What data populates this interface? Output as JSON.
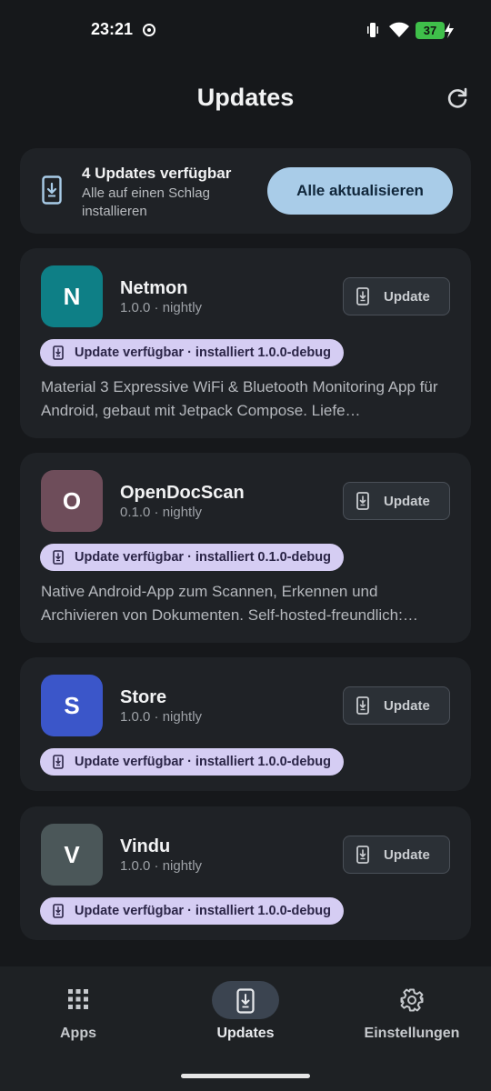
{
  "status_bar": {
    "time": "23:21",
    "battery": "37"
  },
  "header": {
    "title": "Updates"
  },
  "banner": {
    "title": "4 Updates verfügbar",
    "subtitle": "Alle auf einen Schlag installieren",
    "button_label": "Alle aktualisieren"
  },
  "apps": [
    {
      "initial": "N",
      "name": "Netmon",
      "version": "1.0.0 · nightly",
      "button_label": "Update",
      "status": "Update verfügbar · installiert 1.0.0-debug",
      "description": "Material 3 Expressive WiFi & Bluetooth Monitoring App für Android, gebaut mit Jetpack Compose. Liefe…",
      "icon_color": "#0e7f86"
    },
    {
      "initial": "O",
      "name": "OpenDocScan",
      "version": "0.1.0 · nightly",
      "button_label": "Update",
      "status": "Update verfügbar · installiert 0.1.0-debug",
      "description": "Native Android-App zum Scannen, Erkennen und Archivieren von Dokumenten. Self-hosted-freundlich:…",
      "icon_color": "#6e4d5a"
    },
    {
      "initial": "S",
      "name": "Store",
      "version": "1.0.0 · nightly",
      "button_label": "Update",
      "status": "Update verfügbar · installiert 1.0.0-debug",
      "description": "",
      "icon_color": "#3b56c9"
    },
    {
      "initial": "V",
      "name": "Vindu",
      "version": "1.0.0 · nightly",
      "button_label": "Update",
      "status": "Update verfügbar · installiert 1.0.0-debug",
      "description": "",
      "icon_color": "#4b5759"
    }
  ],
  "bottom_nav": {
    "items": [
      {
        "label": "Apps",
        "icon": "grid-icon"
      },
      {
        "label": "Updates",
        "icon": "download-phone-icon",
        "active": true
      },
      {
        "label": "Einstellungen",
        "icon": "gear-icon"
      }
    ]
  },
  "colors": {
    "background": "#16181b",
    "card": "#1f2226",
    "accent_button": "#a9cce8",
    "chip": "#d5cdf3"
  }
}
